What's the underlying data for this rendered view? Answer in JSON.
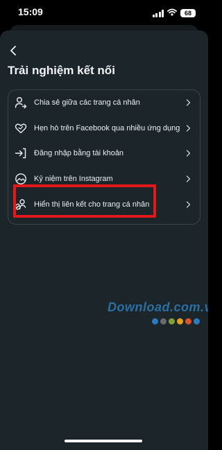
{
  "status_bar": {
    "time": "15:09",
    "battery": "68"
  },
  "header": {
    "back_icon": "chevron-left-icon",
    "title": "Trải nghiệm kết nối"
  },
  "menu": {
    "items": [
      {
        "label": "Chia sẻ giữa các trang cá nhân",
        "icon": "person-share-icon"
      },
      {
        "label": "Hẹn hò trên Facebook qua nhiều ứng dụng",
        "icon": "heart-icon"
      },
      {
        "label": "Đăng nhập bằng tài khoản",
        "icon": "login-arrow-icon"
      },
      {
        "label": "Kỷ niệm trên Instagram",
        "icon": "memories-icon"
      },
      {
        "label": "Hiển thị liên kết cho trang cá nhân",
        "icon": "link-person-icon"
      }
    ]
  },
  "watermark": {
    "text": "Download.com.vn",
    "dot_colors": [
      "#2a7bbf",
      "#6b6b6b",
      "#7fa03a",
      "#e0a21b",
      "#d9532b",
      "#2a7bbf"
    ]
  },
  "colors": {
    "background": "#000000",
    "sheet": "#1c2529",
    "highlight": "#e4181b",
    "text": "#f2f4f5"
  }
}
